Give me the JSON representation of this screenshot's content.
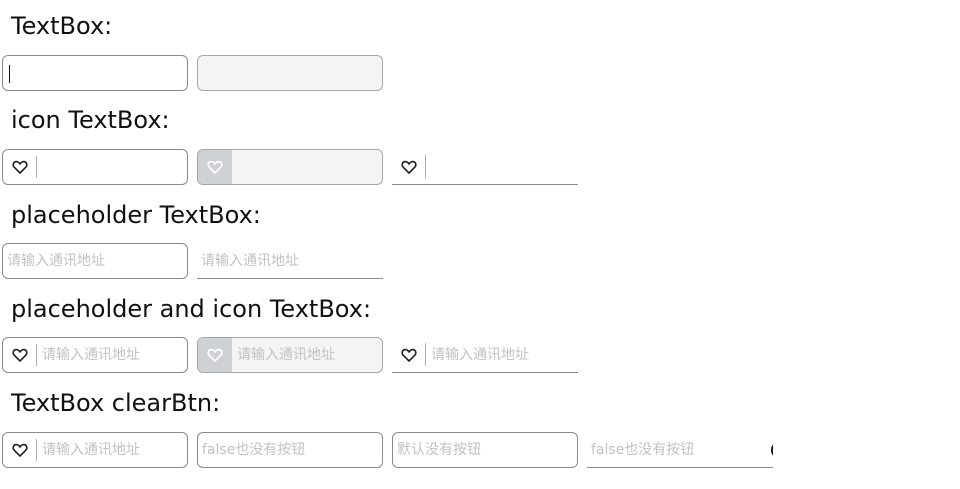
{
  "sections": {
    "textbox": {
      "title": "TextBox:"
    },
    "icon_textbox": {
      "title": "icon TextBox:",
      "icon": "heart-icon"
    },
    "placeholder_textbox": {
      "title": "placeholder TextBox:",
      "placeholders": [
        "请输入通讯地址",
        "请输入通讯地址"
      ]
    },
    "placeholder_icon_textbox": {
      "title": "placeholder and icon TextBox:",
      "icon": "heart-icon",
      "placeholders": [
        "请输入通讯地址",
        "请输入通讯地址",
        "请输入通讯地址"
      ]
    },
    "clearbtn_textbox": {
      "title": "TextBox clearBtn:",
      "icon": "heart-icon",
      "clear_icon": "close-circle-icon",
      "clear_symbol": "✕",
      "placeholders": [
        "请输入通讯地址",
        "false也没有按钮",
        "默认没有按钮",
        "false也没有按钮"
      ]
    }
  }
}
